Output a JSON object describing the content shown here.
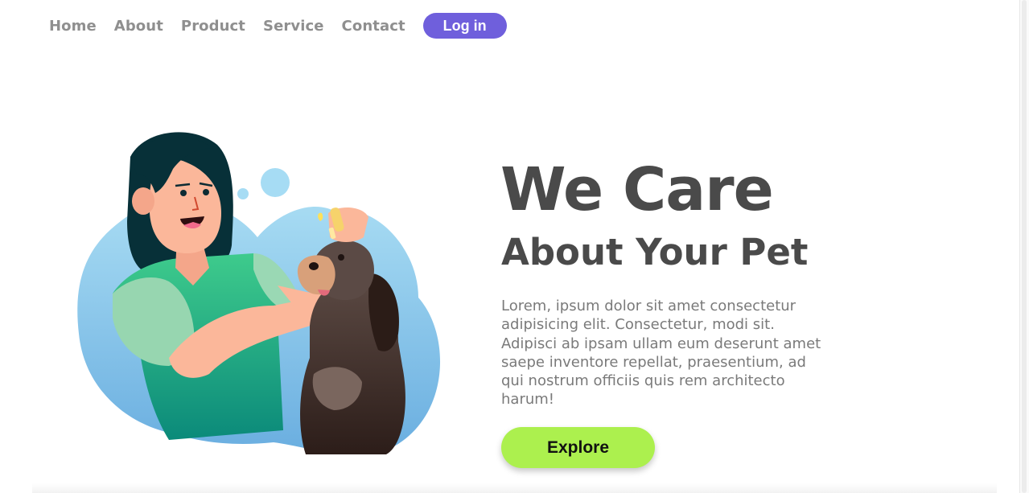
{
  "nav": {
    "links": [
      "Home",
      "About",
      "Product",
      "Service",
      "Contact"
    ],
    "login_label": "Log in"
  },
  "hero": {
    "title": "We Care",
    "subtitle": "About Your Pet",
    "description": "Lorem, ipsum dolor sit amet consectetur adipisicing elit. Consectetur, modi sit. Adipisci ab ipsam ullam eum deserunt amet saepe inventore repellat, praesentium, ad qui nostrum officiis quis rem architecto harum!",
    "explore_label": "Explore"
  },
  "colors": {
    "login_bg": "#6f5fdc",
    "explore_bg": "#acf04e",
    "nav_text": "#8f8f8f",
    "heading_text": "#4a4a4a"
  }
}
